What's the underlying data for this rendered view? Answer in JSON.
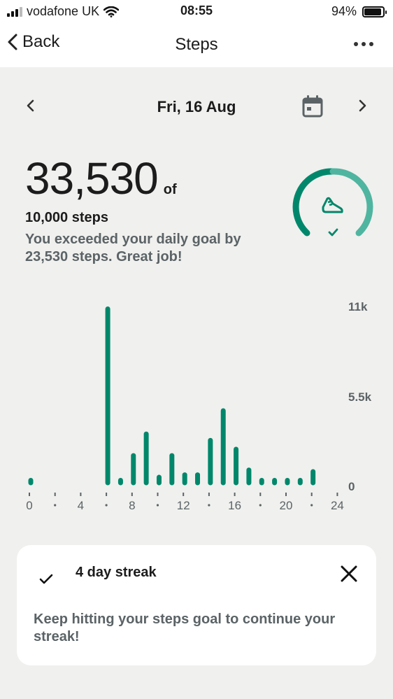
{
  "status_bar": {
    "carrier": "vodafone UK",
    "time": "08:55",
    "battery": "94%",
    "battery_level": 0.94
  },
  "nav": {
    "back_label": "Back",
    "title": "Steps",
    "more_icon": "ellipsis-icon"
  },
  "date": {
    "label": "Fri, 16 Aug",
    "calendar_icon": "calendar-icon"
  },
  "summary": {
    "steps": "33,530",
    "of": "of",
    "goal": "10,000 steps",
    "message": "You exceeded your daily goal by 23,530 steps. Great job!",
    "ring_icon": "shoe-icon",
    "ring_progress": 1.0
  },
  "colors": {
    "accent": "#00876b",
    "accent_light": "#4fb5a0",
    "background": "#f0f0ee",
    "muted_text": "#5b6366"
  },
  "chart_data": {
    "type": "bar",
    "x": [
      0,
      1,
      2,
      3,
      4,
      5,
      6,
      7,
      8,
      9,
      10,
      11,
      12,
      13,
      14,
      15,
      16,
      17,
      18,
      19,
      20,
      21,
      22
    ],
    "values": [
      80,
      0,
      0,
      0,
      0,
      0,
      11000,
      100,
      1850,
      3200,
      500,
      1850,
      650,
      650,
      2800,
      4650,
      2250,
      950,
      150,
      150,
      150,
      150,
      850
    ],
    "ylim": [
      0,
      11000
    ],
    "y_ticks": [
      "11k",
      "5.5k",
      "0"
    ],
    "x_ticks": [
      "0",
      "4",
      "8",
      "12",
      "16",
      "20",
      "24"
    ],
    "bar_color": "#00876b"
  },
  "streak": {
    "title": "4 day streak",
    "body": "Keep hitting your steps goal to continue your streak!"
  }
}
